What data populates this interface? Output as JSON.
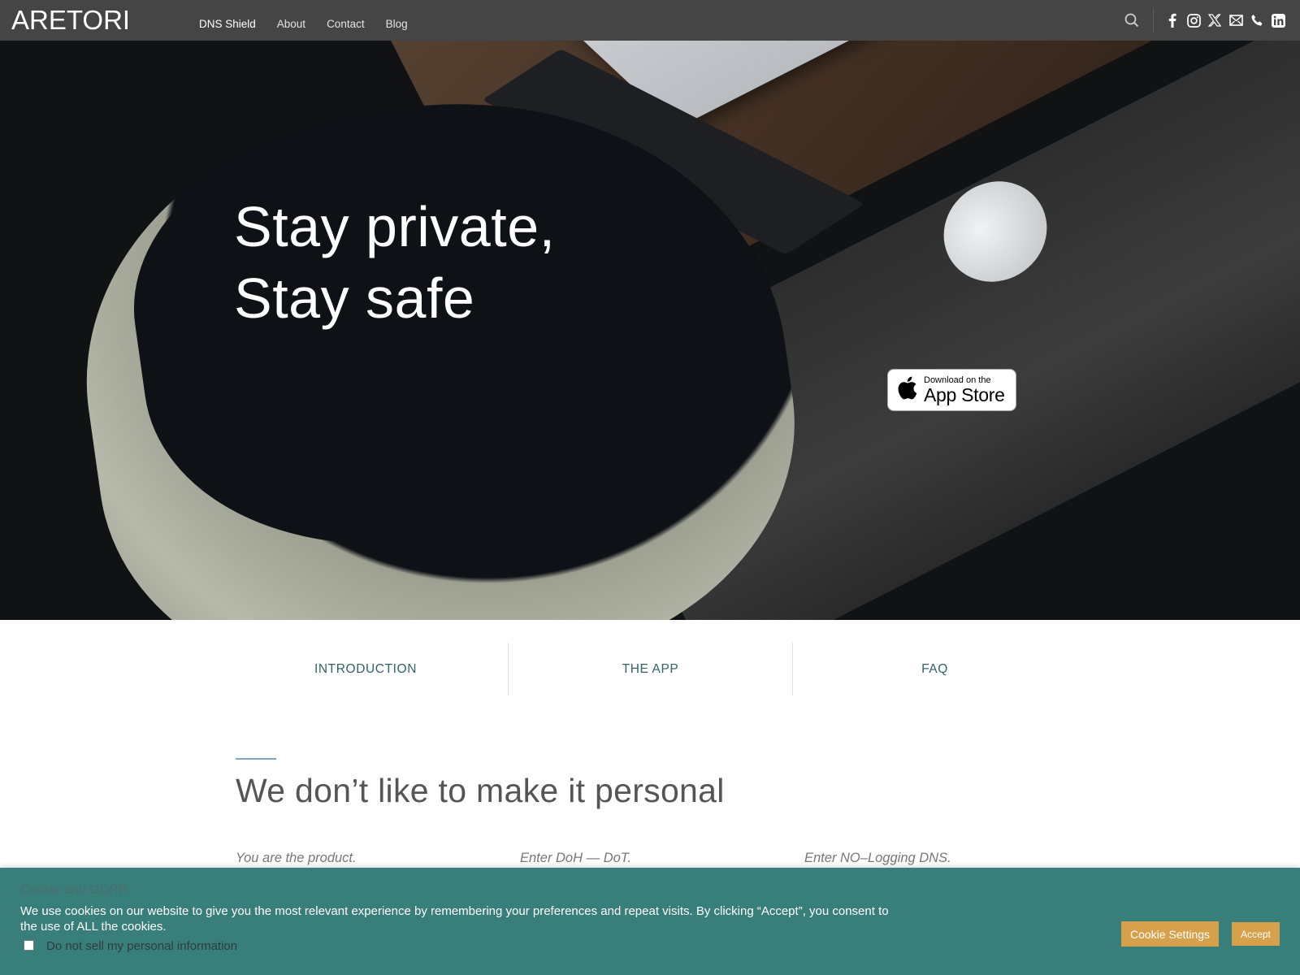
{
  "header": {
    "logo": "ARETORI",
    "nav": [
      {
        "label": "DNS Shield",
        "active": true
      },
      {
        "label": "About"
      },
      {
        "label": "Contact"
      },
      {
        "label": "Blog"
      }
    ],
    "icons": [
      "search-icon",
      "facebook-icon",
      "instagram-icon",
      "x-twitter-icon",
      "email-icon",
      "phone-icon",
      "linkedin-icon"
    ]
  },
  "hero": {
    "title_line1": "Stay private,",
    "title_line2": "Stay safe",
    "appstore": {
      "line1": "Download on the",
      "line2": "App Store"
    }
  },
  "tabs": [
    {
      "label": "INTRODUCTION"
    },
    {
      "label": "THE APP"
    },
    {
      "label": "FAQ"
    }
  ],
  "section": {
    "title": "We don’t like to make it personal",
    "columns": [
      {
        "title": "You are the product."
      },
      {
        "title": "Enter DoH — DoT."
      },
      {
        "title": "Enter NO–Logging DNS."
      }
    ]
  },
  "cookie": {
    "title": "Cookie and GDPR",
    "text": "We use cookies on our website to give you the most relevant experience by remembering your preferences and repeat visits. By clicking “Accept”, you consent to the use of ALL the cookies.",
    "checkbox_label": "Do not sell my personal information",
    "checkbox_checked": false,
    "settings_label": "Cookie Settings",
    "accept_label": "Accept"
  },
  "colors": {
    "header_bg": "#454545",
    "accent_teal": "#387e7b",
    "tab_text": "#2e6467",
    "button_gold": "#d7a04a"
  }
}
